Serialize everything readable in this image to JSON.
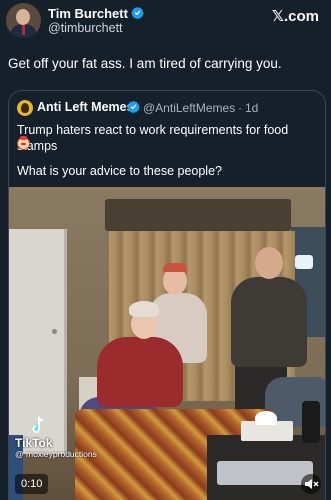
{
  "tweet": {
    "author": {
      "name": "Tim Burchett",
      "handle": "@timburchett",
      "verified": true
    },
    "brand": "𝕏.com",
    "text": "Get off your fat ass. I am tired of carrying you."
  },
  "quoted": {
    "author": {
      "name": "Anti Left Memes",
      "handle": "@AntiLeftMemes",
      "verified": true
    },
    "separator": "·",
    "time": "1d",
    "text_line1": "Trump haters react to work requirements for food stamps",
    "text_line2": "What is your advice to these people?",
    "emoji": "clown-face-icon"
  },
  "video": {
    "watermark_app": "TikTok",
    "watermark_user": "@ moxleyproductions",
    "timestamp": "0:10",
    "mute_icon": "speaker-muted-icon"
  },
  "colors": {
    "background": "#15202b",
    "verified_blue": "#1d9bf0",
    "text_primary": "#ffffff",
    "text_secondary": "#aab4bd",
    "quote_border": "#3a4654"
  }
}
